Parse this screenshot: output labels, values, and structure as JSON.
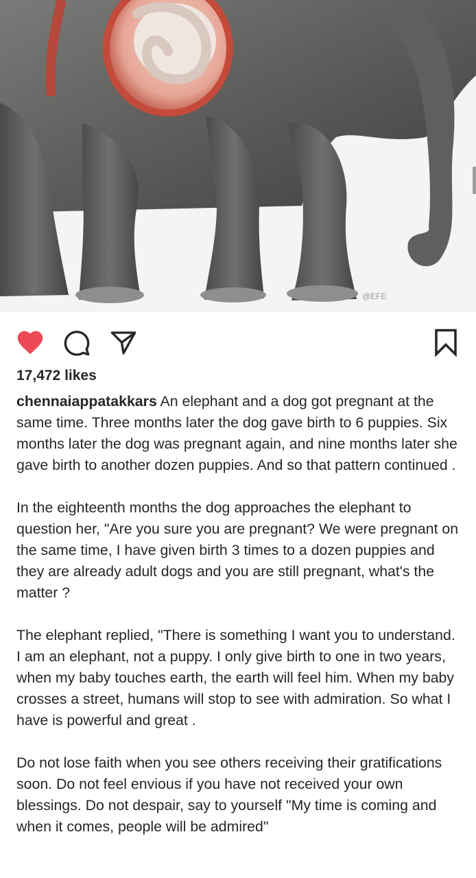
{
  "post": {
    "image_alt": "Illustration of an elephant with a cutaway view of a calf in the womb",
    "watermark": "@EFE"
  },
  "actions": {
    "like_icon": "heart-filled-icon",
    "comment_icon": "comment-bubble-icon",
    "share_icon": "paper-plane-icon",
    "save_icon": "bookmark-icon",
    "like_color": "#ed4956"
  },
  "likes": "17,472 likes",
  "caption": {
    "username": "chennaiappatakkars",
    "paragraph1": "An elephant and a dog got pregnant at the same time. Three months later the dog gave birth to 6 puppies. Six months later the dog was pregnant again, and nine months later she gave birth to another dozen puppies. And so that pattern continued .",
    "paragraph2": "In the eighteenth months the dog approaches the elephant to question her, \"Are you sure you are pregnant? We were pregnant on the same time, I have given birth 3 times to a dozen puppies and they are already adult dogs and you are still pregnant, what's the matter ?",
    "paragraph3": "The elephant replied, \"There is something I want you to understand. I am an elephant, not a puppy. I only give birth to one in two years, when my baby touches earth, the earth will feel him. When my baby crosses a street, humans will stop to see with admiration. So what I have is powerful and great .",
    "paragraph4": "Do not lose faith when you see others receiving their gratifications soon. Do not feel envious if you have not received your own blessings. Do not despair, say to yourself \"My time is coming and when it comes, people will be admired\""
  }
}
